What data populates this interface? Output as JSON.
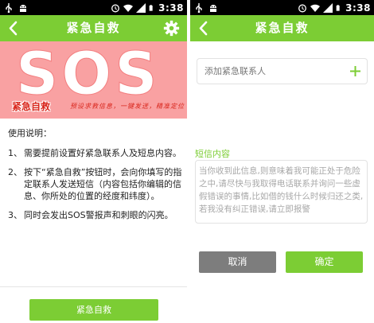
{
  "colors": {
    "accent": "#7ccd34",
    "banner": "#f9a1a2",
    "banner_text": "#d9261c",
    "cancel": "#7d7d7d"
  },
  "status_bar": {
    "time": "3:38"
  },
  "left_screen": {
    "title": "紧急自救",
    "banner": {
      "logo_text": "SOS",
      "title": "紧急自救",
      "slogan": "预设求救信息，一键发送，精准定位"
    },
    "instructions": {
      "heading": "使用说明：",
      "items": [
        {
          "num": "1、",
          "text": "需要提前设置好紧急联系人及短息内容。"
        },
        {
          "num": "2、",
          "text": "按下“紧急自救”按钮时，会向你填写的指定联系人发送短信（内容包括你编辑的信息、你所处的位置的经度和纬度）。"
        },
        {
          "num": "3、",
          "text": "同时会发出SOS警报声和刺眼的闪亮。"
        }
      ]
    },
    "action_button": "紧急自救"
  },
  "right_screen": {
    "title": "紧急自救",
    "contact_placeholder": "添加紧急联系人",
    "sms_label": "短信内容",
    "sms_placeholder": "当你收到此信息,则意味着我可能正处于危险之中,请尽快与我取得电话联系并询问一些虚假错误的事情,比如借的钱什么时候归还之类,若我没有纠正错误,请立即报警",
    "cancel_button": "取消",
    "confirm_button": "确定"
  },
  "icons": [
    "usb-icon",
    "android-debug-icon",
    "alarm-icon",
    "wifi-icon",
    "signal-icon",
    "battery-icon",
    "back-arrow-icon",
    "gear-icon",
    "plus-icon"
  ]
}
